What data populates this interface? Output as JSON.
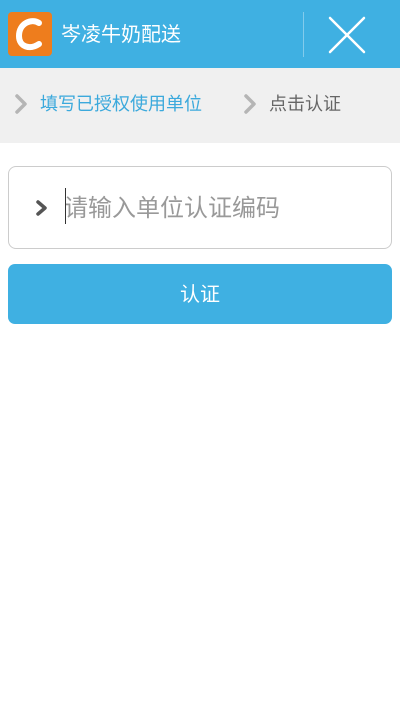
{
  "header": {
    "logo_icon": "orange-c-logo-icon",
    "title": "岑凌牛奶配送",
    "close_icon": "close-x-icon"
  },
  "breadcrumb": {
    "items": [
      {
        "label": "填写已授权使用单位",
        "active": true
      },
      {
        "label": "点击认证",
        "active": false
      }
    ],
    "separator_icon": "chevron-right-icon"
  },
  "form": {
    "code_input": {
      "value": "",
      "placeholder": "请输入单位认证编码",
      "leading_icon": "chevron-right-icon"
    },
    "submit_label": "认证"
  },
  "colors": {
    "primary": "#3fb0e2",
    "logo": "#ee7d1d",
    "breadcrumb_bg": "#f0f0f0",
    "link": "#3ba9dc"
  }
}
